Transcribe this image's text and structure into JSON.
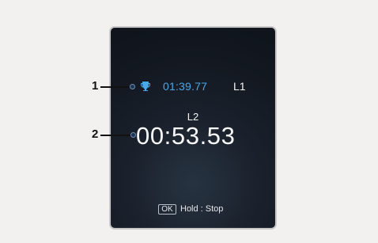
{
  "callouts": [
    {
      "label": "1"
    },
    {
      "label": "2"
    }
  ],
  "display": {
    "best": {
      "icon": "trophy-icon",
      "time": "01:39.77",
      "lap": "L1"
    },
    "current": {
      "lap": "L2",
      "time": "00:53.53"
    },
    "hint": {
      "button": "OK",
      "text": "Hold : Stop"
    },
    "colors": {
      "accent": "#49a8e8",
      "background": "#131821",
      "text": "#f4f4f4"
    }
  }
}
